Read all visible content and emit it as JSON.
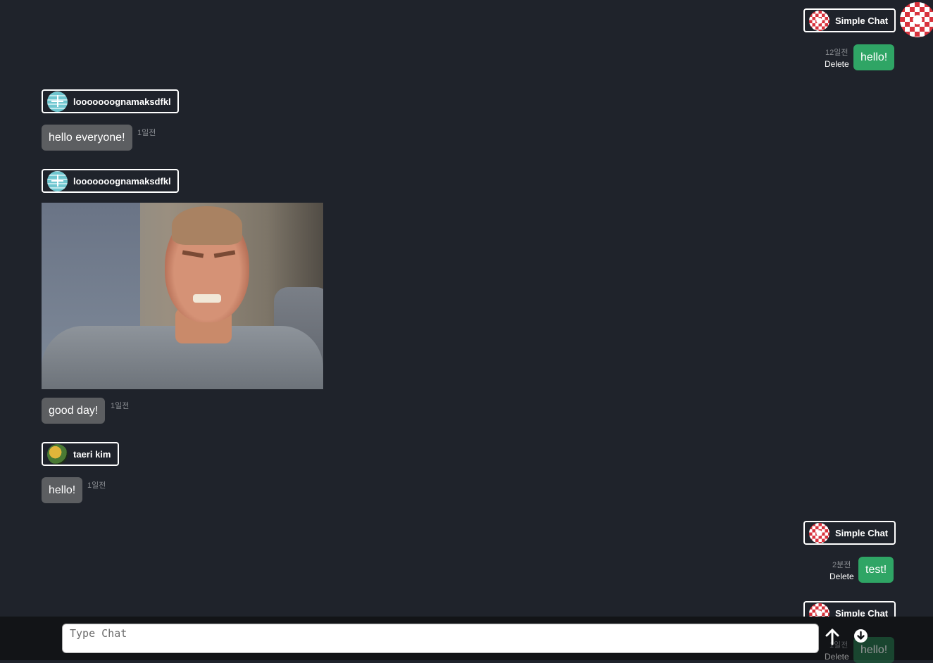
{
  "messages": [
    {
      "user": "Simple Chat",
      "text": "hello!",
      "time": "12일전",
      "delete": "Delete"
    },
    {
      "user": "looooooognamaksdfkl",
      "text": "hello everyone!",
      "time": "1일전"
    },
    {
      "user": "looooooognamaksdfkl",
      "text": "good day!",
      "time": "1일전"
    },
    {
      "user": "taeri kim",
      "text": "hello!",
      "time": "1일전"
    },
    {
      "user": "Simple Chat",
      "text": "test!",
      "time": "2분전",
      "delete": "Delete"
    },
    {
      "user": "Simple Chat",
      "text": "hello!",
      "time": "1일전",
      "delete": "Delete"
    }
  ],
  "composer": {
    "placeholder": "Type Chat"
  },
  "colors": {
    "background": "#1f232b",
    "own_bubble": "#2fa565",
    "other_bubble": "#5c5e61",
    "bottom_bar": "#121417"
  },
  "icons": {
    "send": "arrow-up-icon",
    "scroll_down": "arrow-down-circle-icon"
  }
}
